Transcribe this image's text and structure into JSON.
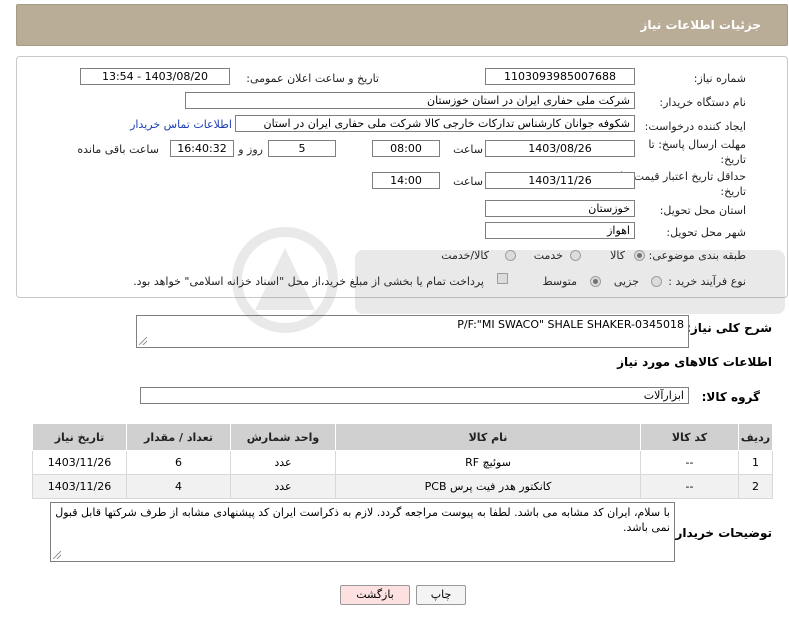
{
  "header": {
    "title": "جزئیات اطلاعات نیاز"
  },
  "fields": {
    "need_number_label": "شماره نیاز:",
    "need_number": "1103093985007688",
    "announce_label": "تاریخ و ساعت اعلان عمومی:",
    "announce_value": "1403/08/20 - 13:54",
    "buyer_org_label": "نام دستگاه خریدار:",
    "buyer_org": "شرکت ملی حفاری ایران در استان خوزستان",
    "creator_label": "ایجاد کننده درخواست:",
    "creator": "شکوفه جوانان کارشناس تدارکات خارجی کالا شرکت ملی حفاری ایران در استان",
    "contact_link": "اطلاعات تماس خریدار",
    "reply_deadline_label": "مهلت ارسال پاسخ: تا تاریخ:",
    "reply_date": "1403/08/26",
    "time_label": "ساعت",
    "reply_time": "08:00",
    "days_value": "5",
    "days_label": "روز و",
    "remaining_time": "16:40:32",
    "remaining_label": "ساعت باقی مانده",
    "price_validity_label": "حداقل تاریخ اعتبار قیمت: تا تاریخ:",
    "validity_date": "1403/11/26",
    "validity_time": "14:00",
    "province_label": "استان محل تحویل:",
    "province": "خوزستان",
    "city_label": "شهر محل تحویل:",
    "city": "اهواز",
    "category_label": "طبقه بندی موضوعی:",
    "category_options": [
      "کالا",
      "خدمت",
      "کالا/خدمت"
    ],
    "purchase_type_label": "نوع فرآیند خرید :",
    "purchase_options": [
      "جزیی",
      "متوسط"
    ],
    "payment_note": "پرداخت تمام یا بخشی از مبلغ خرید،از محل \"اسناد خزانه اسلامی\" خواهد بود."
  },
  "description": {
    "label": "شرح کلی نیاز:",
    "value": "P/F:\"MI SWACO\" SHALE SHAKER-0345018"
  },
  "goods_info": {
    "title": "اطلاعات کالاهای مورد نیاز",
    "group_label": "گروه کالا:",
    "group_value": "ابزارآلات"
  },
  "table": {
    "headers": [
      "ردیف",
      "کد کالا",
      "نام کالا",
      "واحد شمارش",
      "تعداد / مقدار",
      "تاریخ نیاز"
    ],
    "rows": [
      [
        "1",
        "--",
        "سوئیچ RF",
        "عدد",
        "6",
        "1403/11/26"
      ],
      [
        "2",
        "--",
        "کانکتور هدر فیت پرس PCB",
        "عدد",
        "4",
        "1403/11/26"
      ]
    ]
  },
  "buyer_notes": {
    "label": "توضیحات خریدار:",
    "value": "با سلام، ایران کد مشابه می باشد. لطفا به پیوست مراجعه گردد. لازم به ذکراست ایران کد پیشنهادی مشابه از طرف شرکتها قابل قبول نمی باشد."
  },
  "buttons": {
    "print": "چاپ",
    "back": "بازگشت"
  },
  "colors": {
    "header_bg": "#b9ad98",
    "back_btn_bg": "#fde1e1",
    "link": "#1b3fb4"
  }
}
